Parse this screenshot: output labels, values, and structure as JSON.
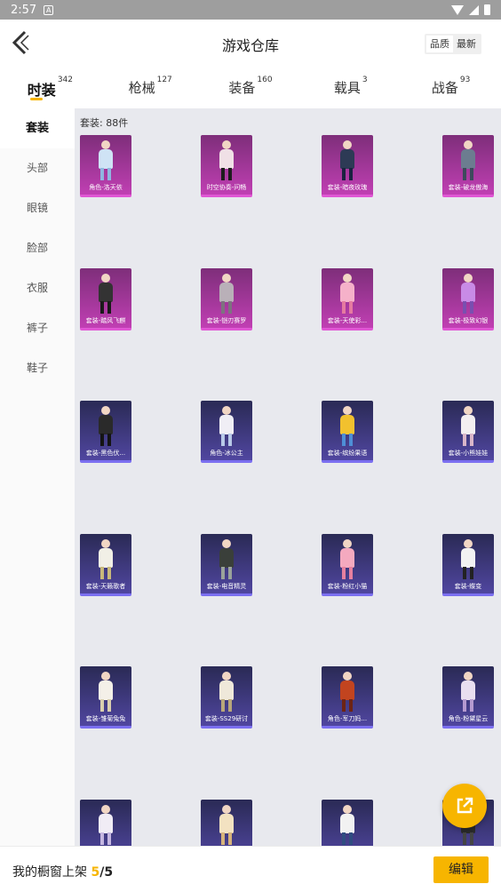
{
  "statusbar": {
    "time": "2:57",
    "notif_glyph": "A"
  },
  "header": {
    "title": "游戏仓库",
    "sort": [
      "品质",
      "最新"
    ]
  },
  "tabs": [
    {
      "label": "时装",
      "count": "342",
      "active": true
    },
    {
      "label": "枪械",
      "count": "127",
      "active": false
    },
    {
      "label": "装备",
      "count": "160",
      "active": false
    },
    {
      "label": "载具",
      "count": "3",
      "active": false
    },
    {
      "label": "战备",
      "count": "93",
      "active": false
    }
  ],
  "sidebar": [
    "套装",
    "头部",
    "眼镜",
    "脸部",
    "衣服",
    "裤子",
    "鞋子"
  ],
  "content": {
    "count_label": "套装: 88件"
  },
  "items": [
    {
      "label": "角色-洛天依",
      "style": "pink",
      "c1": "#cfe3f5",
      "c2": "#8fb6e0"
    },
    {
      "label": "时空协奏-问畅",
      "style": "pink",
      "c1": "#f0e0e6",
      "c2": "#1d1d1d"
    },
    {
      "label": "套装-暗夜玫瑰",
      "style": "pink",
      "c1": "#2d3a55",
      "c2": "#1a2240"
    },
    {
      "label": "套装-破龙傲海",
      "style": "pink",
      "c1": "#6c7d90",
      "c2": "#3d4a5c"
    },
    {
      "label": "套装-踏风飞麒",
      "style": "pink",
      "c1": "#333333",
      "c2": "#1a1a1a"
    },
    {
      "label": "套装-铠刃赛罗",
      "style": "pink",
      "c1": "#b9b0b8",
      "c2": "#7d7380"
    },
    {
      "label": "套装-天使彩...",
      "style": "pink",
      "c1": "#f5b1c9",
      "c2": "#e57aa0"
    },
    {
      "label": "套装-极致幻银",
      "style": "pink",
      "c1": "#c88be6",
      "c2": "#7a4fb0"
    },
    {
      "label": "套装-黑色伏...",
      "style": "violet",
      "c1": "#2a2a2a",
      "c2": "#141414"
    },
    {
      "label": "角色-冰公主",
      "style": "violet",
      "c1": "#f0eef5",
      "c2": "#b8c9e8"
    },
    {
      "label": "套装-缤纷果语",
      "style": "violet",
      "c1": "#f2c12e",
      "c2": "#4e8ed6"
    },
    {
      "label": "套装-小熊娃娃",
      "style": "violet",
      "c1": "#f3eef0",
      "c2": "#d9b6c9"
    },
    {
      "label": "套装-天籁歌者",
      "style": "violet",
      "c1": "#f1efe6",
      "c2": "#c8b97a"
    },
    {
      "label": "套装-电音精灵",
      "style": "violet",
      "c1": "#3a3f3a",
      "c2": "#9aa39a"
    },
    {
      "label": "套装-粉红小猫",
      "style": "violet",
      "c1": "#f4a9bf",
      "c2": "#e6809f"
    },
    {
      "label": "套装-蝶变",
      "style": "violet",
      "c1": "#f2f2f2",
      "c2": "#222222"
    },
    {
      "label": "套装-雏菊兔兔",
      "style": "violet",
      "c1": "#f4f0e8",
      "c2": "#d9cfae"
    },
    {
      "label": "套装-SS29研讨",
      "style": "violet",
      "c1": "#efe8da",
      "c2": "#b9a77a"
    },
    {
      "label": "角色-军刀妈...",
      "style": "violet",
      "c1": "#c2441f",
      "c2": "#6d2414"
    },
    {
      "label": "角色-粉黛星云",
      "style": "violet",
      "c1": "#e9dff0",
      "c2": "#b59ad0"
    },
    {
      "label": "",
      "style": "violet",
      "c1": "#f0ecf5",
      "c2": "#c4b6e0"
    },
    {
      "label": "",
      "style": "violet",
      "c1": "#f3e2c1",
      "c2": "#d6b37a"
    },
    {
      "label": "",
      "style": "violet",
      "c1": "#f2f2f2",
      "c2": "#2f4d80"
    },
    {
      "label": "",
      "style": "violet",
      "c1": "#2a2a2a",
      "c2": "#444444"
    }
  ],
  "footer": {
    "text": "我的橱窗上架",
    "current": "5",
    "total": "/5",
    "edit_label": "编辑"
  },
  "colors": {
    "accent": "#f7b500"
  }
}
